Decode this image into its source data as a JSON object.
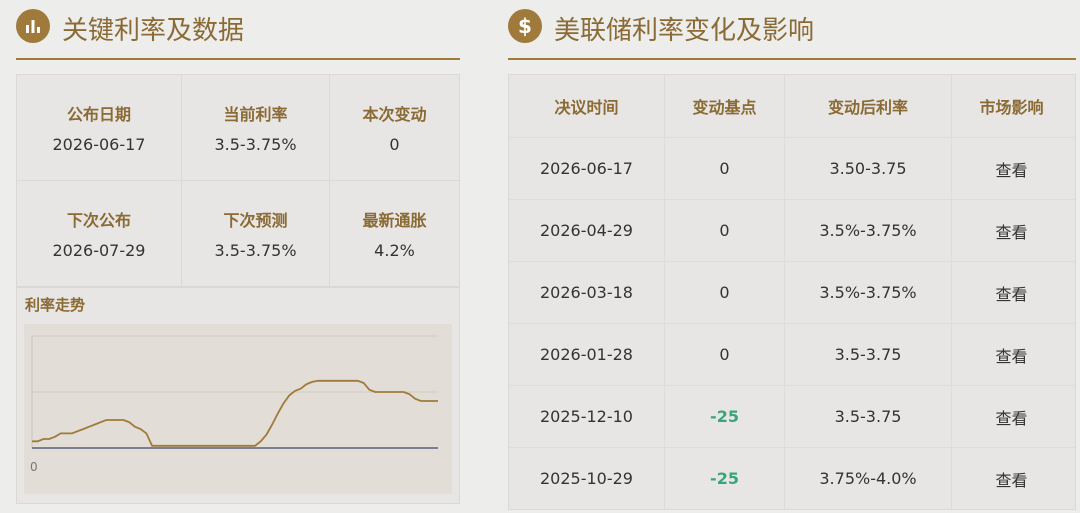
{
  "left": {
    "icon": "bar-chart-icon",
    "title": "关键利率及数据",
    "stats": [
      {
        "label": "公布日期",
        "value": "2026-06-17"
      },
      {
        "label": "当前利率",
        "value": "3.5-3.75%"
      },
      {
        "label": "本次变动",
        "value": "0"
      },
      {
        "label": "下次公布",
        "value": "2026-07-29"
      },
      {
        "label": "下次预测",
        "value": "3.5-3.75%"
      },
      {
        "label": "最新通胀",
        "value": "4.2%"
      }
    ],
    "trend_label": "利率走势",
    "axis_zero": "0"
  },
  "right": {
    "icon": "dollar-icon",
    "icon_glyph": "$",
    "title": "美联储利率变化及影响",
    "headers": [
      "决议时间",
      "变动基点",
      "变动后利率",
      "市场影响"
    ],
    "rows": [
      {
        "date": "2026-06-17",
        "bp": "0",
        "rate": "3.50-3.75",
        "action": "查看"
      },
      {
        "date": "2026-04-29",
        "bp": "0",
        "rate": "3.5%-3.75%",
        "action": "查看"
      },
      {
        "date": "2026-03-18",
        "bp": "0",
        "rate": "3.5%-3.75%",
        "action": "查看"
      },
      {
        "date": "2026-01-28",
        "bp": "0",
        "rate": "3.5-3.75",
        "action": "查看"
      },
      {
        "date": "2025-12-10",
        "bp": "-25",
        "rate": "3.5-3.75",
        "action": "查看"
      },
      {
        "date": "2025-10-29",
        "bp": "-25",
        "rate": "3.75%-4.0%",
        "action": "查看"
      }
    ]
  },
  "colors": {
    "accent": "#a07a3a",
    "negative": "#3aa57a",
    "line": "#a07a3a"
  },
  "chart_data": {
    "type": "line",
    "title": "利率走势",
    "xlabel": "",
    "ylabel": "",
    "tick_labels": [
      "0"
    ],
    "grid": true,
    "series": [
      {
        "values": [
          0.06,
          0.06,
          0.08,
          0.08,
          0.1,
          0.13,
          0.13,
          0.13,
          0.15,
          0.17,
          0.19,
          0.21,
          0.23,
          0.25,
          0.25,
          0.25,
          0.25,
          0.23,
          0.19,
          0.17,
          0.13,
          0.02,
          0.02,
          0.02,
          0.02,
          0.02,
          0.02,
          0.02,
          0.02,
          0.02,
          0.02,
          0.02,
          0.02,
          0.02,
          0.02,
          0.02,
          0.02,
          0.02,
          0.02,
          0.02,
          0.06,
          0.12,
          0.21,
          0.31,
          0.4,
          0.47,
          0.51,
          0.53,
          0.57,
          0.59,
          0.6,
          0.6,
          0.6,
          0.6,
          0.6,
          0.6,
          0.6,
          0.6,
          0.58,
          0.52,
          0.5,
          0.5,
          0.5,
          0.5,
          0.5,
          0.5,
          0.48,
          0.44,
          0.42,
          0.42,
          0.42,
          0.42
        ]
      }
    ]
  }
}
